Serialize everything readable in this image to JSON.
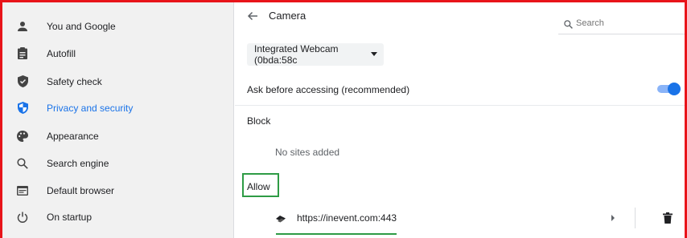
{
  "sidebar": {
    "items": [
      {
        "label": "You and Google",
        "icon": "person-icon"
      },
      {
        "label": "Autofill",
        "icon": "clipboard-icon"
      },
      {
        "label": "Safety check",
        "icon": "shield-check-icon"
      },
      {
        "label": "Privacy and security",
        "icon": "shield-icon",
        "active": true
      },
      {
        "label": "Appearance",
        "icon": "palette-icon"
      },
      {
        "label": "Search engine",
        "icon": "search-icon"
      },
      {
        "label": "Default browser",
        "icon": "browser-icon"
      },
      {
        "label": "On startup",
        "icon": "power-icon"
      }
    ]
  },
  "header": {
    "title": "Camera",
    "search_placeholder": "Search"
  },
  "camera_select": {
    "value": "Integrated Webcam (0bda:58c"
  },
  "ask_setting": {
    "label": "Ask before accessing (recommended)",
    "enabled": true
  },
  "block_section": {
    "title": "Block",
    "empty_text": "No sites added"
  },
  "allow_section": {
    "title": "Allow",
    "sites": [
      {
        "url": "https://inevent.com:443"
      }
    ]
  },
  "colors": {
    "accent": "#1a73e8",
    "highlight_red": "#e8141a",
    "highlight_green": "#2e9b45"
  }
}
